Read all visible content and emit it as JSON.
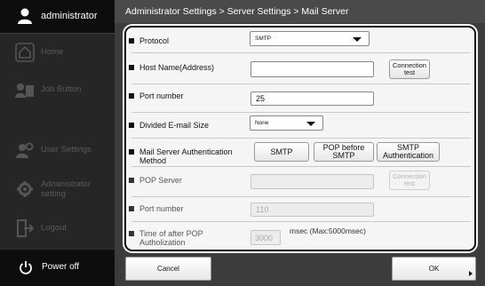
{
  "sidebar": {
    "user": {
      "name": "administrator",
      "icon": "user-icon"
    },
    "items": [
      {
        "label": "Home",
        "icon": "home-icon"
      },
      {
        "label": "Job Button",
        "icon": "job-button-icon"
      },
      {
        "label": "User Settings",
        "icon": "user-settings-icon"
      },
      {
        "label": "Administrator setting",
        "icon": "administrator-setting-icon"
      },
      {
        "label": "Logout",
        "icon": "logout-icon"
      }
    ],
    "power": {
      "label": "Power off",
      "icon": "power-icon"
    }
  },
  "breadcrumb": "Administrator Settings > Server Settings > Mail Server",
  "form": {
    "protocol": {
      "label": "Protocol",
      "value": "SMTP"
    },
    "host": {
      "label": "Host Name(Address)",
      "value": "",
      "button": "Connection test"
    },
    "port": {
      "label": "Port number",
      "value": "25"
    },
    "divided": {
      "label": "Divided E-mail Size",
      "value": "None"
    },
    "auth": {
      "label": "Mail Server Authentication Method",
      "options": [
        "SMTP",
        "POP before SMTP",
        "SMTP Authentication"
      ]
    },
    "pop_server": {
      "label": "POP Server",
      "value": "",
      "button": "Connection test"
    },
    "pop_port": {
      "label": "Port number",
      "value": "110"
    },
    "pop_time": {
      "label": "Time of after POP Autholization",
      "value": "3000",
      "suffix": "msec (Max:5000msec)"
    }
  },
  "footer": {
    "cancel": "Cancel",
    "ok": "OK"
  },
  "colors": {
    "sidebar": "#262626",
    "header": "#4a4a4a",
    "panel": "#f5f5f5",
    "disabled_text": "#5a5a5a"
  }
}
